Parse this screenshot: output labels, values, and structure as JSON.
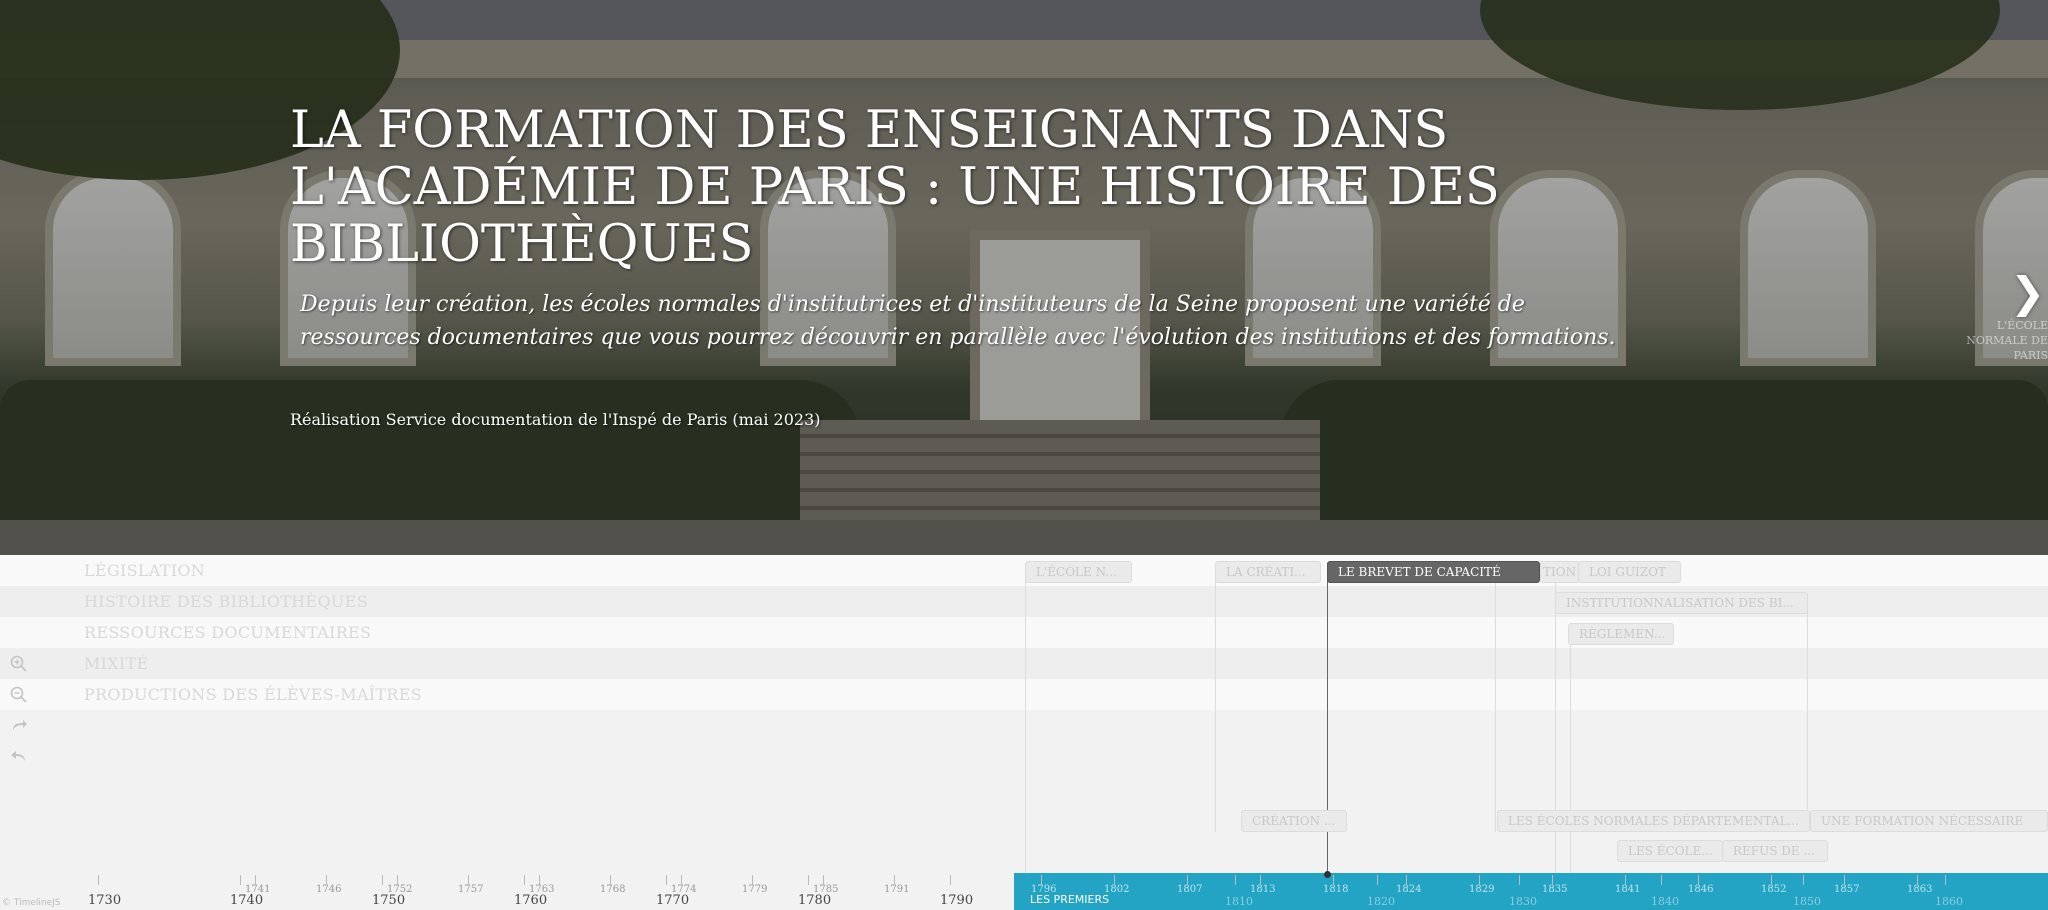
{
  "hero": {
    "title": "LA FORMATION DES ENSEIGNANTS DANS L'ACADÉMIE DE PARIS : UNE HISTOIRE DES BIBLIOTHÈQUES",
    "subtitle": "Depuis leur création, les écoles normales d'institutrices et d'instituteurs de la Seine proposent une variété de ressources documentaires que vous pourrez découvrir en parallèle avec l'évolution des institutions et des formations.",
    "credit": "Réalisation Service documentation de l'Inspé de Paris (mai 2023)",
    "next_arrow": "❯",
    "next_preview": "L'ÉCOLE NORMALE DE PARIS"
  },
  "timeline": {
    "groups": [
      "LÉGISLATION",
      "HISTOIRE DES BIBLIOTHÈQUES",
      "RESSOURCES DOCUMENTAIRES",
      "MIXITÉ",
      "PRODUCTIONS DES ÉLÈVES-MAÎTRES"
    ],
    "markers": {
      "m1": "L'ÉCOLE N...",
      "m2": "LA CRÉATI...",
      "m3": "LE BREVET DE CAPACITÉ",
      "m4": "TION",
      "m5": "LOI GUIZOT",
      "m6": "INSTITUTIONNALISATION DES BI...",
      "m7": "RÈGLEMEN...",
      "m8": "CRÉATION ...",
      "m9": "LES ÉCOLES NORMALES DÉPARTEMENTAL...",
      "m10": "UNE FORMATION NÉCESSAIRE",
      "m11": "LES ÉCOLE...",
      "m12": "REFUS DE ..."
    },
    "zoom_icons": [
      "zoom-in-icon",
      "zoom-out-icon",
      "redo-icon",
      "back-icon"
    ]
  },
  "timenav": {
    "attribution": "© TimelineJS",
    "era_label": "LES PREMIERS",
    "major_ticks": [
      "1730",
      "1740",
      "1750",
      "1760",
      "1770",
      "1780",
      "1790"
    ],
    "minor_ticks": [
      "1741",
      "1746",
      "1752",
      "1757",
      "1763",
      "1768",
      "1774",
      "1779",
      "1785",
      "1791"
    ],
    "era_minor_ticks": [
      "1796",
      "1802",
      "1807",
      "1813",
      "1818",
      "1824",
      "1829",
      "1835",
      "1841",
      "1846",
      "1852",
      "1857",
      "1863"
    ],
    "era_major_ticks": [
      "1810",
      "1820",
      "1830",
      "1840",
      "1850",
      "1860"
    ]
  }
}
